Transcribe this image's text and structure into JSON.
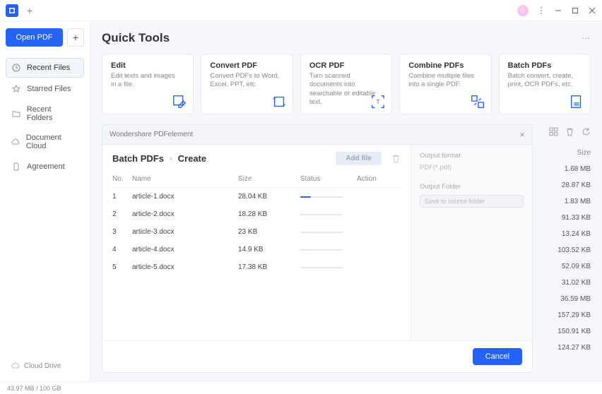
{
  "titlebar": {
    "avatar": "user-avatar"
  },
  "sidebar": {
    "open_label": "Open PDF",
    "items": [
      {
        "label": "Recent Files",
        "icon": "clock-icon",
        "active": true
      },
      {
        "label": "Starred Files",
        "icon": "star-icon"
      },
      {
        "label": "Recent Folders",
        "icon": "folder-icon"
      },
      {
        "label": "Document Cloud",
        "icon": "cloud-icon"
      },
      {
        "label": "Agreement",
        "icon": "doc-icon"
      }
    ],
    "cloud_drive": "Cloud Drive"
  },
  "header": {
    "title": "Quick Tools"
  },
  "cards": [
    {
      "title": "Edit",
      "desc": "Edit texts and images in a file."
    },
    {
      "title": "Convert PDF",
      "desc": "Convert PDFs to Word, Excel, PPT, etc."
    },
    {
      "title": "OCR PDF",
      "desc": "Turn scanned documents into searchable or editable text."
    },
    {
      "title": "Combine PDFs",
      "desc": "Combine multiple files into a single PDF."
    },
    {
      "title": "Batch PDFs",
      "desc": "Batch convert, create, print, OCR PDFs, etc."
    }
  ],
  "sizes": {
    "header": "Size",
    "items": [
      "1.68 MB",
      "28.87 KB",
      "1.83 MB",
      "91.33 KB",
      "13.24 KB",
      "103.52 KB",
      "52.09 KB",
      "31.02 KB",
      "36.59 MB",
      "157.29 KB",
      "150.91 KB",
      "124.27 KB"
    ]
  },
  "modal": {
    "title": "Wondershare PDFelement",
    "breadcrumb": {
      "root": "Batch PDFs",
      "current": "Create"
    },
    "add_file": "Add file",
    "columns": {
      "no": "No.",
      "name": "Name",
      "size": "Size",
      "status": "Status",
      "action": "Action"
    },
    "rows": [
      {
        "no": "1",
        "name": "article-1.docx",
        "size": "28.04 KB"
      },
      {
        "no": "2",
        "name": "article-2.docx",
        "size": "18.28 KB"
      },
      {
        "no": "3",
        "name": "article-3.docx",
        "size": "23 KB"
      },
      {
        "no": "4",
        "name": "article-4.docx",
        "size": "14.9 KB"
      },
      {
        "no": "5",
        "name": "article-5.docx",
        "size": "17.38 KB"
      }
    ],
    "right": {
      "output_format_label": "Output format",
      "output_format_value": "PDF(*.pdf)",
      "output_folder_label": "Output Folder",
      "output_folder_value": "Save to source folder"
    },
    "cancel": "Cancel"
  },
  "statusbar": {
    "storage": "43.97 MB / 100 GB"
  }
}
